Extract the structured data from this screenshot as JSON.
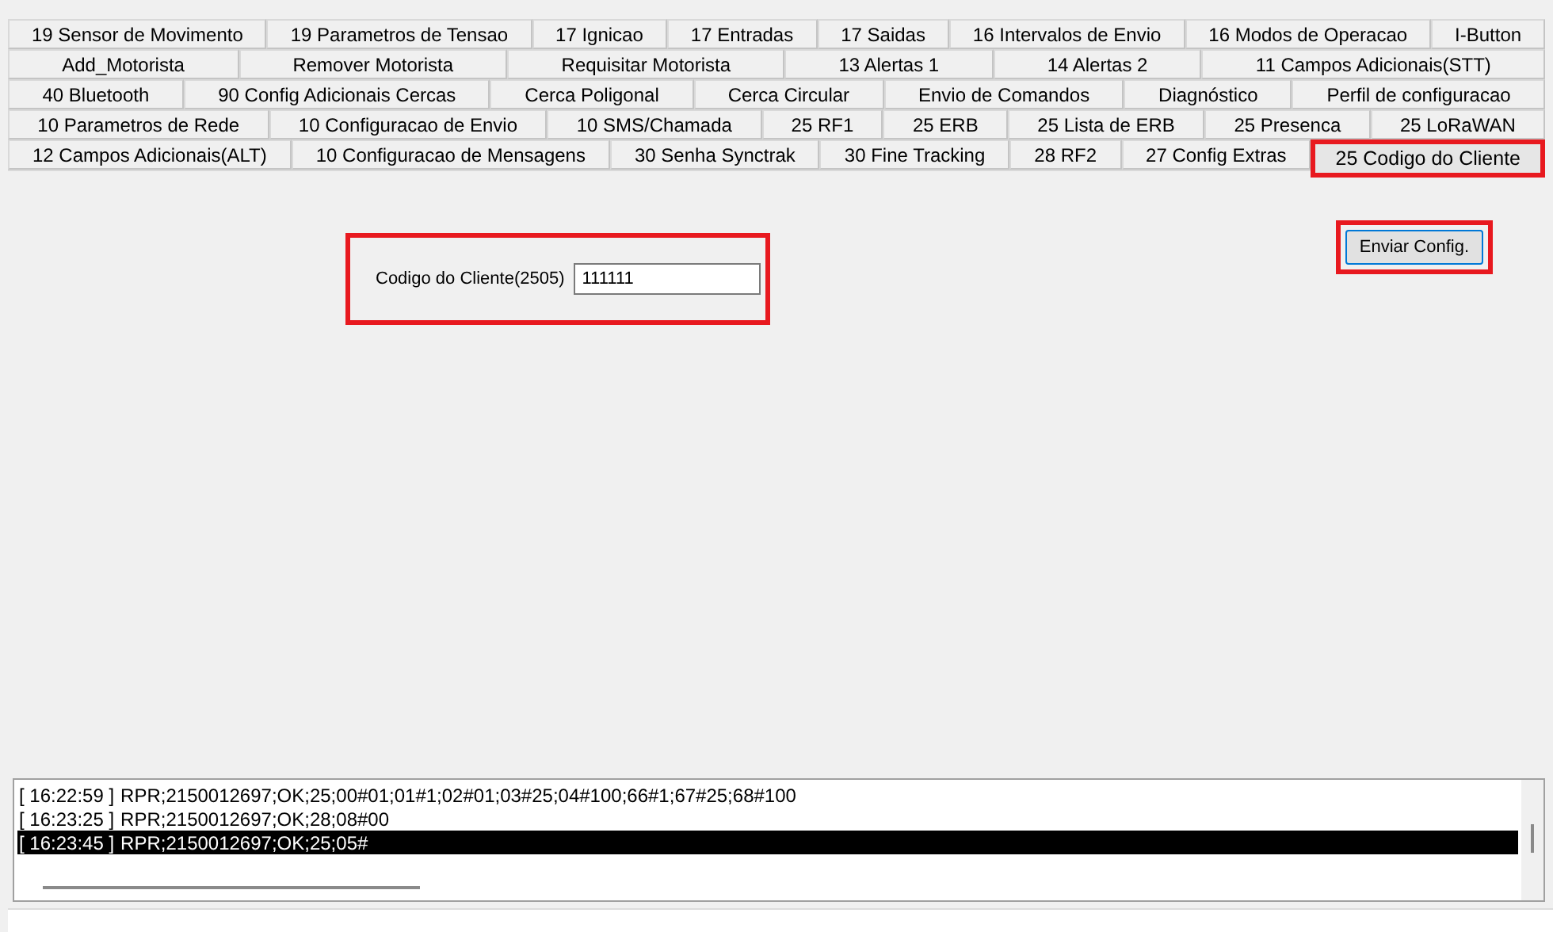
{
  "tab_rows": [
    {
      "tabs": [
        {
          "label": "19 Sensor de Movimento",
          "selected": false,
          "highlighted": false
        },
        {
          "label": "19 Parametros de Tensao",
          "selected": false,
          "highlighted": false
        },
        {
          "label": "17 Ignicao",
          "selected": false,
          "highlighted": false
        },
        {
          "label": "17 Entradas",
          "selected": false,
          "highlighted": false
        },
        {
          "label": "17 Saidas",
          "selected": false,
          "highlighted": false
        },
        {
          "label": "16 Intervalos de Envio",
          "selected": false,
          "highlighted": false
        },
        {
          "label": "16 Modos de Operacao",
          "selected": false,
          "highlighted": false
        },
        {
          "label": "I-Button",
          "selected": false,
          "highlighted": false
        }
      ]
    },
    {
      "tabs": [
        {
          "label": "Add_Motorista",
          "selected": false,
          "highlighted": false
        },
        {
          "label": "Remover Motorista",
          "selected": false,
          "highlighted": false
        },
        {
          "label": "Requisitar Motorista",
          "selected": false,
          "highlighted": false
        },
        {
          "label": "13 Alertas 1",
          "selected": false,
          "highlighted": false
        },
        {
          "label": "14 Alertas 2",
          "selected": false,
          "highlighted": false
        },
        {
          "label": "11 Campos Adicionais(STT)",
          "selected": false,
          "highlighted": false
        }
      ]
    },
    {
      "tabs": [
        {
          "label": "40 Bluetooth",
          "selected": false,
          "highlighted": false
        },
        {
          "label": "90 Config Adicionais Cercas",
          "selected": false,
          "highlighted": false
        },
        {
          "label": "Cerca Poligonal",
          "selected": false,
          "highlighted": false
        },
        {
          "label": "Cerca Circular",
          "selected": false,
          "highlighted": false
        },
        {
          "label": "Envio de Comandos",
          "selected": false,
          "highlighted": false
        },
        {
          "label": "Diagnóstico",
          "selected": false,
          "highlighted": false
        },
        {
          "label": "Perfil de configuracao",
          "selected": false,
          "highlighted": false
        }
      ]
    },
    {
      "tabs": [
        {
          "label": "10 Parametros de Rede",
          "selected": false,
          "highlighted": false
        },
        {
          "label": "10 Configuracao de Envio",
          "selected": false,
          "highlighted": false
        },
        {
          "label": "10 SMS/Chamada",
          "selected": false,
          "highlighted": false
        },
        {
          "label": "25 RF1",
          "selected": false,
          "highlighted": false
        },
        {
          "label": "25 ERB",
          "selected": false,
          "highlighted": false
        },
        {
          "label": "25 Lista de ERB",
          "selected": false,
          "highlighted": false
        },
        {
          "label": "25 Presenca",
          "selected": false,
          "highlighted": false
        },
        {
          "label": "25 LoRaWAN",
          "selected": false,
          "highlighted": false
        }
      ]
    },
    {
      "tabs": [
        {
          "label": "12 Campos Adicionais(ALT)",
          "selected": false,
          "highlighted": false
        },
        {
          "label": "10 Configuracao de Mensagens",
          "selected": false,
          "highlighted": false
        },
        {
          "label": "30 Senha Synctrak",
          "selected": false,
          "highlighted": false
        },
        {
          "label": "30 Fine Tracking",
          "selected": false,
          "highlighted": false
        },
        {
          "label": "28 RF2",
          "selected": false,
          "highlighted": false
        },
        {
          "label": "27 Config Extras",
          "selected": false,
          "highlighted": false
        },
        {
          "label": "25 Codigo do Cliente",
          "selected": true,
          "highlighted": true
        }
      ]
    }
  ],
  "form": {
    "label": "Codigo do Cliente(2505)",
    "value": "111111",
    "highlighted": true
  },
  "send_button": {
    "label": "Enviar Config.",
    "highlighted": true
  },
  "log": [
    {
      "time": "[ 16:22:59 ]",
      "message": "RPR;2150012697;OK;25;00#01;01#1;02#01;03#25;04#100;66#1;67#25;68#100",
      "selected": false
    },
    {
      "time": "[ 16:23:25 ]",
      "message": "RPR;2150012697;OK;28;08#00",
      "selected": false
    },
    {
      "time": "[ 16:23:45 ]",
      "message": "RPR;2150012697;OK;25;05#",
      "selected": true
    }
  ]
}
